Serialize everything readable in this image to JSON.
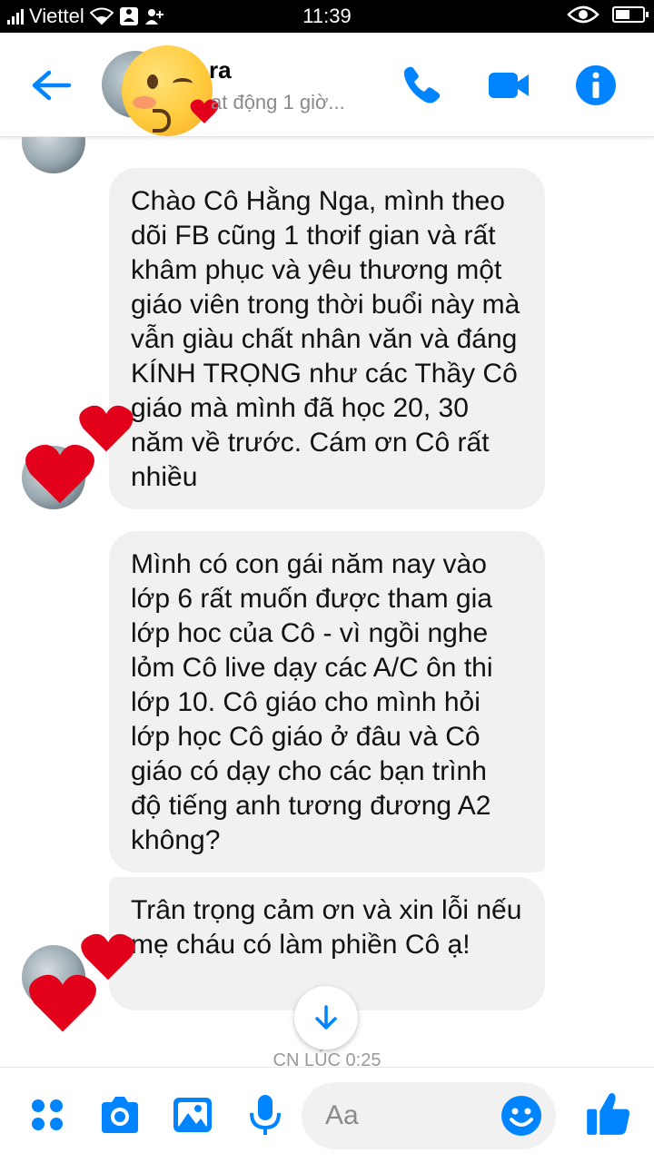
{
  "status_bar": {
    "carrier": "Viettel",
    "time": "11:39",
    "battery_level": 0.55
  },
  "header": {
    "contact_name": "ra",
    "activity_status": "ạt động 1 giờ..."
  },
  "messages": [
    "Chào Cô Hằng Nga, mình theo dõi FB cũng 1 thơif gian và rất khâm phục và yêu thương một giáo viên trong thời buổi này mà vẫn giàu chất nhân văn và đáng KÍNH TRỌNG như các Thầy Cô giáo mà mình đã học 20, 30 năm về trước. Cám ơn Cô rất nhiều",
    "Mình có con gái năm nay vào lớp 6 rất muốn được tham gia lớp hoc của Cô - vì ngồi nghe lỏm Cô live dạy các A/C ôn thi lớp 10. Cô giáo cho mình hỏi lớp học Cô giáo ở đâu và Cô giáo có dạy cho các bạn trình độ tiếng anh tương đương A2 không?",
    "Trân trọng cảm ơn và xin lỗi nếu mẹ cháu có làm phiền Cô ạ!"
  ],
  "timestamp": "CN LÚC 0:25",
  "composer": {
    "placeholder": "Aa"
  },
  "colors": {
    "accent": "#0084ff",
    "bubble": "#f1f1f1",
    "heart": "#e3001b"
  }
}
